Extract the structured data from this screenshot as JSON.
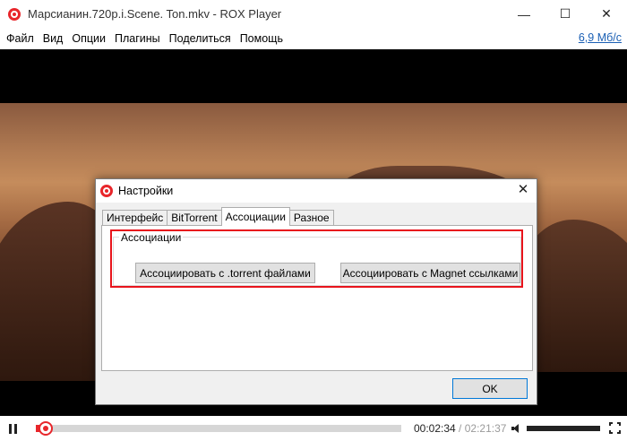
{
  "window": {
    "title": "Марсианин.720p.i.Scene. Ton.mkv - ROX Player",
    "controls": {
      "minimize": "—",
      "maximize": "☐",
      "close": "✕"
    }
  },
  "menu": {
    "items": [
      "Файл",
      "Вид",
      "Опции",
      "Плагины",
      "Поделиться",
      "Помощь"
    ],
    "speed": "6,9 Мб/с"
  },
  "dialog": {
    "title": "Настройки",
    "close": "✕",
    "tabs": [
      "Интерфейс",
      "BitTorrent",
      "Ассоциации",
      "Разное"
    ],
    "active_tab": "Ассоциации",
    "group_label": "Ассоциации",
    "buttons": {
      "torrent": "Ассоциировать с .torrent файлами",
      "magnet": "Ассоциировать с Magnet ссылками",
      "ok": "OK"
    }
  },
  "player": {
    "progress_fraction": 0.018,
    "time_current": "00:02:34",
    "time_separator": " / ",
    "time_total": "02:21:37",
    "volume_fraction": 1.0
  },
  "colors": {
    "accent": "#e8262b",
    "highlight": "#e8141c",
    "link": "#1a5fb4"
  },
  "icons": [
    "app-logo-icon",
    "pause-icon",
    "volume-icon",
    "fullscreen-icon",
    "close-icon"
  ]
}
